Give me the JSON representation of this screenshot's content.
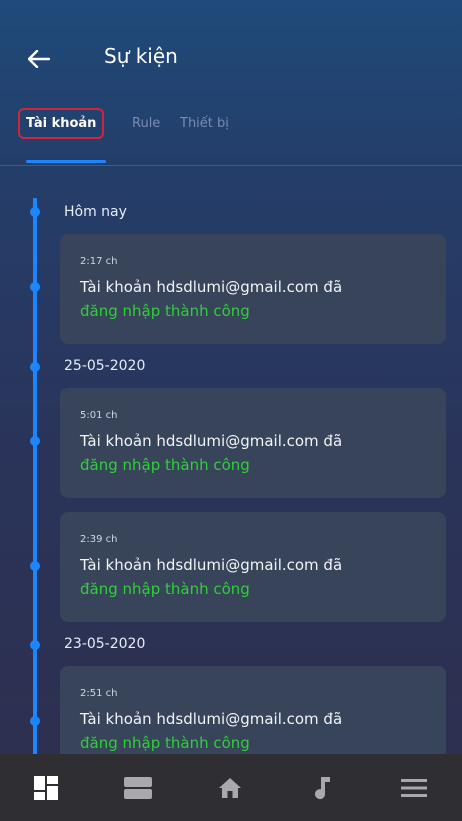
{
  "header": {
    "title": "Sự kiện",
    "back_icon": "arrow-left-icon"
  },
  "tabs": [
    {
      "label": "Tài khoản",
      "active": true
    },
    {
      "label": "Rule",
      "active": false
    },
    {
      "label": "Thiết bị",
      "active": false
    }
  ],
  "timeline": {
    "groups": [
      {
        "date": "Hôm nay",
        "events": [
          {
            "time": "2:17 ch",
            "text": "Tài khoản hdsdlumi@gmail.com đã",
            "status": "đăng nhập thành công"
          }
        ]
      },
      {
        "date": "25-05-2020",
        "events": [
          {
            "time": "5:01 ch",
            "text": "Tài khoản hdsdlumi@gmail.com đã",
            "status": "đăng nhập thành công"
          },
          {
            "time": "2:39 ch",
            "text": "Tài khoản hdsdlumi@gmail.com đã",
            "status": "đăng nhập thành công"
          }
        ]
      },
      {
        "date": "23-05-2020",
        "events": [
          {
            "time": "2:51 ch",
            "text": "Tài khoản hdsdlumi@gmail.com đã",
            "status": "đăng nhập thành công"
          }
        ]
      }
    ]
  },
  "bottom_nav": [
    {
      "icon": "dashboard-icon",
      "active": true
    },
    {
      "icon": "devices-icon",
      "active": false
    },
    {
      "icon": "home-icon",
      "active": false
    },
    {
      "icon": "music-icon",
      "active": false
    },
    {
      "icon": "menu-icon",
      "active": false
    }
  ],
  "colors": {
    "accent": "#1c86ff",
    "success": "#2fcf3a",
    "highlight_border": "#d0263a",
    "card_bg": "#38445a",
    "nav_bg": "#2f2f33"
  }
}
